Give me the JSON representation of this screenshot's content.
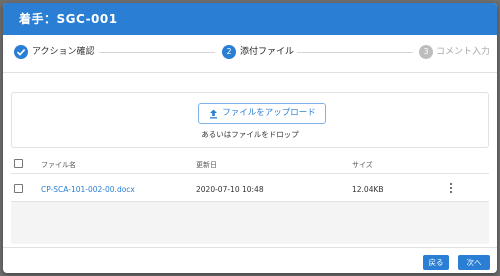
{
  "dialog": {
    "title": "着手：SGC-001"
  },
  "stepper": {
    "steps": [
      {
        "number": "1",
        "label": "アクション確認",
        "state": "done"
      },
      {
        "number": "2",
        "label": "添付ファイル",
        "state": "active"
      },
      {
        "number": "3",
        "label": "コメント入力",
        "state": "pending"
      }
    ]
  },
  "upload": {
    "button_label": "ファイルをアップロード",
    "drop_text": "あるいはファイルをドロップ"
  },
  "table": {
    "columns": [
      "ファイル名",
      "更新日",
      "サイズ"
    ],
    "rows": [
      {
        "name": "CP-SCA-101-002-00.docx",
        "updated": "2020-07-10 10:48",
        "size": "12.04KB"
      }
    ]
  },
  "footer": {
    "back_label": "戻る",
    "next_label": "次へ"
  },
  "colors": {
    "primary": "#2a7fd4",
    "done": "#2a7fd4",
    "pending": "#bdbdbd"
  }
}
